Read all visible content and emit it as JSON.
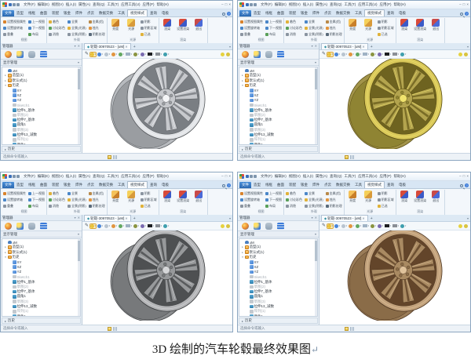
{
  "caption": {
    "text": "3D 绘制的汽车轮毂最终效果图",
    "return_mark": "↵"
  },
  "window": {
    "menus": [
      "文件(F)",
      "编辑(E)",
      "视图(V)",
      "插入(I)",
      "属性(A)",
      "查询(Q)",
      "工具(T)",
      "应用工具(U)",
      "应用(P)",
      "帮助(H)"
    ],
    "window_controls": [
      "‒",
      "□",
      "×"
    ],
    "ribbon_tabs": [
      {
        "label": "文件",
        "kind": "file"
      },
      {
        "label": "造型",
        "kind": "normal"
      },
      {
        "label": "线框",
        "kind": "normal"
      },
      {
        "label": "曲面",
        "kind": "normal"
      },
      {
        "label": "装配",
        "kind": "normal"
      },
      {
        "label": "钣金",
        "kind": "normal"
      },
      {
        "label": "焊件",
        "kind": "normal"
      },
      {
        "label": "点云",
        "kind": "normal"
      },
      {
        "label": "数据交换",
        "kind": "normal"
      },
      {
        "label": "工具",
        "kind": "normal"
      },
      {
        "label": "视觉样式",
        "kind": "active"
      },
      {
        "label": "查询",
        "kind": "normal"
      },
      {
        "label": "电极",
        "kind": "normal"
      }
    ],
    "ribbon_groups": [
      {
        "label": "视图",
        "type": "cols",
        "cols": [
          [
            {
              "t": "设置视图属性",
              "c": "#d9822b"
            },
            {
              "t": "设置旋转轴",
              "c": "#4a86c8"
            },
            {
              "t": "重叠",
              "c": "#8a94a0"
            }
          ],
          [
            {
              "t": "上一视图",
              "c": "#4a86c8"
            },
            {
              "t": "下一视图",
              "c": "#4a86c8"
            },
            {
              "t": "布局",
              "c": "#5aa05a"
            }
          ]
        ]
      },
      {
        "label": "外观",
        "type": "cols",
        "cols": [
          [
            {
              "t": "着色",
              "c": "#e0b23a"
            },
            {
              "t": "讨论彩色",
              "c": "#5aa05a"
            },
            {
              "t": "消隐",
              "c": "#8a94a0"
            }
          ],
          [
            {
              "t": "全景",
              "c": "#4a86c8"
            },
            {
              "t": "全景(光源)",
              "c": "#e0b23a"
            },
            {
              "t": "全景(阴影)",
              "c": "#8a94a0"
            }
          ],
          [
            {
              "t": "金属(铝)",
              "c": "#b8894a"
            },
            {
              "t": "烛光",
              "c": "#e2953f"
            },
            {
              "t": "阴影处理",
              "c": "#5a6a7a"
            }
          ]
        ]
      },
      {
        "label": "光源",
        "type": "mixed",
        "big": [
          {
            "t": "亮度",
            "c1": "#f5c25a",
            "c2": "#c87f2a"
          },
          {
            "t": "光源",
            "c1": "#f5d05a",
            "c2": "#d89a3a"
          }
        ],
        "small": [
          {
            "t": "阴影",
            "c": "#8a94a0"
          },
          {
            "t": "阴影区域",
            "c": "#8a94a0"
          },
          {
            "t": "已选",
            "c": "#e0b23a"
          }
        ]
      },
      {
        "label": "渲染",
        "type": "big",
        "big": [
          {
            "t": "渲染",
            "c1": "#d84a3a",
            "c2": "#3a5ac8"
          },
          {
            "t": "设置渲染",
            "c1": "#d84a3a",
            "c2": "#3a5ac8"
          },
          {
            "t": "退出",
            "c1": "#c84a4a",
            "c2": "#4a6ad8"
          }
        ]
      }
    ],
    "manager": {
      "title": "管理器",
      "pin": "▾",
      "close": "✕",
      "tab_icons": [
        "history-manager-icon",
        "assembly-manager-icon",
        "visual-manager-icon",
        "layer-manager-icon"
      ],
      "section_label": "显示管理",
      "section_caret": "▾",
      "tree": [
        {
          "d": 0,
          "icon": "user",
          "t": "uM",
          "caret": ""
        },
        {
          "d": 0,
          "icon": "folder",
          "t": "造型(1)",
          "caret": "▸"
        },
        {
          "d": 0,
          "icon": "folder",
          "t": "默认式(1)",
          "caret": "▸"
        },
        {
          "d": 0,
          "icon": "folder",
          "t": "历史",
          "caret": "▾"
        },
        {
          "d": 1,
          "icon": "plane",
          "t": "XY",
          "caret": ""
        },
        {
          "d": 1,
          "icon": "plane",
          "t": "XZ",
          "caret": ""
        },
        {
          "d": 1,
          "icon": "plane",
          "t": "YZ",
          "caret": ""
        },
        {
          "d": 1,
          "icon": "grey",
          "t": "Sketch1",
          "caret": "",
          "grey": true
        },
        {
          "d": 1,
          "icon": "solid",
          "t": "拉伸1_基体",
          "caret": ""
        },
        {
          "d": 1,
          "icon": "grey",
          "t": "草图(2)",
          "caret": "",
          "grey": true
        },
        {
          "d": 1,
          "icon": "solid",
          "t": "拉伸7_基体",
          "caret": ""
        },
        {
          "d": 1,
          "icon": "solid",
          "t": "圆角1",
          "caret": ""
        },
        {
          "d": 1,
          "icon": "grey",
          "t": "草图(3)",
          "caret": "",
          "grey": true
        },
        {
          "d": 1,
          "icon": "solid",
          "t": "拉伸13_减数",
          "caret": ""
        },
        {
          "d": 1,
          "icon": "grey",
          "t": "阵列(1)",
          "caret": "",
          "grey": true
        },
        {
          "d": 1,
          "icon": "solid",
          "t": "倒角1",
          "caret": ""
        }
      ],
      "footer_caret": "▸",
      "footer_label": "历史"
    },
    "doc_tab": {
      "diamond": "◆",
      "label": "轮毂-30970523 - [uM]",
      "close": "✕",
      "plus": "+",
      "overflow": "▾"
    },
    "da_toolbar": {
      "pencil": "✎",
      "icons": [
        {
          "name": "shade-mode-icon",
          "shape": "dot",
          "color": "#e8c33a",
          "hl": true
        },
        {
          "name": "wireframe-mode-icon",
          "shape": "dot",
          "color": "#4a86d8"
        },
        {
          "name": "hidden-line-icon",
          "shape": "dot",
          "color": "#b8c4d0"
        },
        {
          "name": "render-mode-icon",
          "shape": "dot",
          "color": "#e2953f"
        },
        {
          "name": "section-view-icon",
          "shape": "dot",
          "color": "#63a861"
        },
        {
          "name": "grid-toggle-icon",
          "shape": "sw",
          "color": "#9fb2c4"
        },
        {
          "name": "sketch-edit-icon",
          "shape": "dot",
          "color": "#8a9440"
        },
        {
          "name": "material-icon",
          "shape": "dot",
          "color": "#7a6bb0"
        },
        {
          "name": "black-swatch-icon",
          "shape": "sw",
          "color": "#1d1f22"
        },
        {
          "name": "gray-swatch-icon",
          "shape": "sw",
          "color": "#8a8f96"
        },
        {
          "name": "background-icon",
          "shape": "dot",
          "color": "#3f9fae"
        }
      ],
      "right_icons": [
        {
          "name": "zoom-all-icon",
          "color": "#e6d23f"
        },
        {
          "name": "view-orient-icon",
          "color": "#d9c43f"
        }
      ]
    },
    "statusbar": {
      "hint": "选择命令或输入"
    }
  },
  "windows": [
    {
      "variant": "silver",
      "wheel": {
        "rim": "#e2e4e7",
        "spoke": "#c7c9cd",
        "dark": "#7a7e83",
        "inner": "#9a9da1",
        "line": "#55585c",
        "hi": "#f4f5f7",
        "barrel": "#b7babe"
      }
    },
    {
      "variant": "gold",
      "wheel": {
        "rim": "#d9c85a",
        "spoke": "#b3a44e",
        "dark": "#6e6320",
        "inner": "#8f8433",
        "line": "#55490f",
        "hi": "#f0e36e",
        "barrel": "#a2944a"
      }
    },
    {
      "variant": "gunmetal",
      "wheel": {
        "rim": "#b4b5b7",
        "spoke": "#97999b",
        "dark": "#4e5052",
        "inner": "#77797b",
        "line": "#3a3c3e",
        "hi": "#d5d6d8",
        "barrel": "#8b8d8f"
      }
    },
    {
      "variant": "bronze",
      "wheel": {
        "rim": "#c2a27c",
        "spoke": "#a98a62",
        "dark": "#63452a",
        "inner": "#8a6c48",
        "line": "#4c3420",
        "hi": "#dfc29b",
        "barrel": "#9a7c58"
      }
    }
  ]
}
